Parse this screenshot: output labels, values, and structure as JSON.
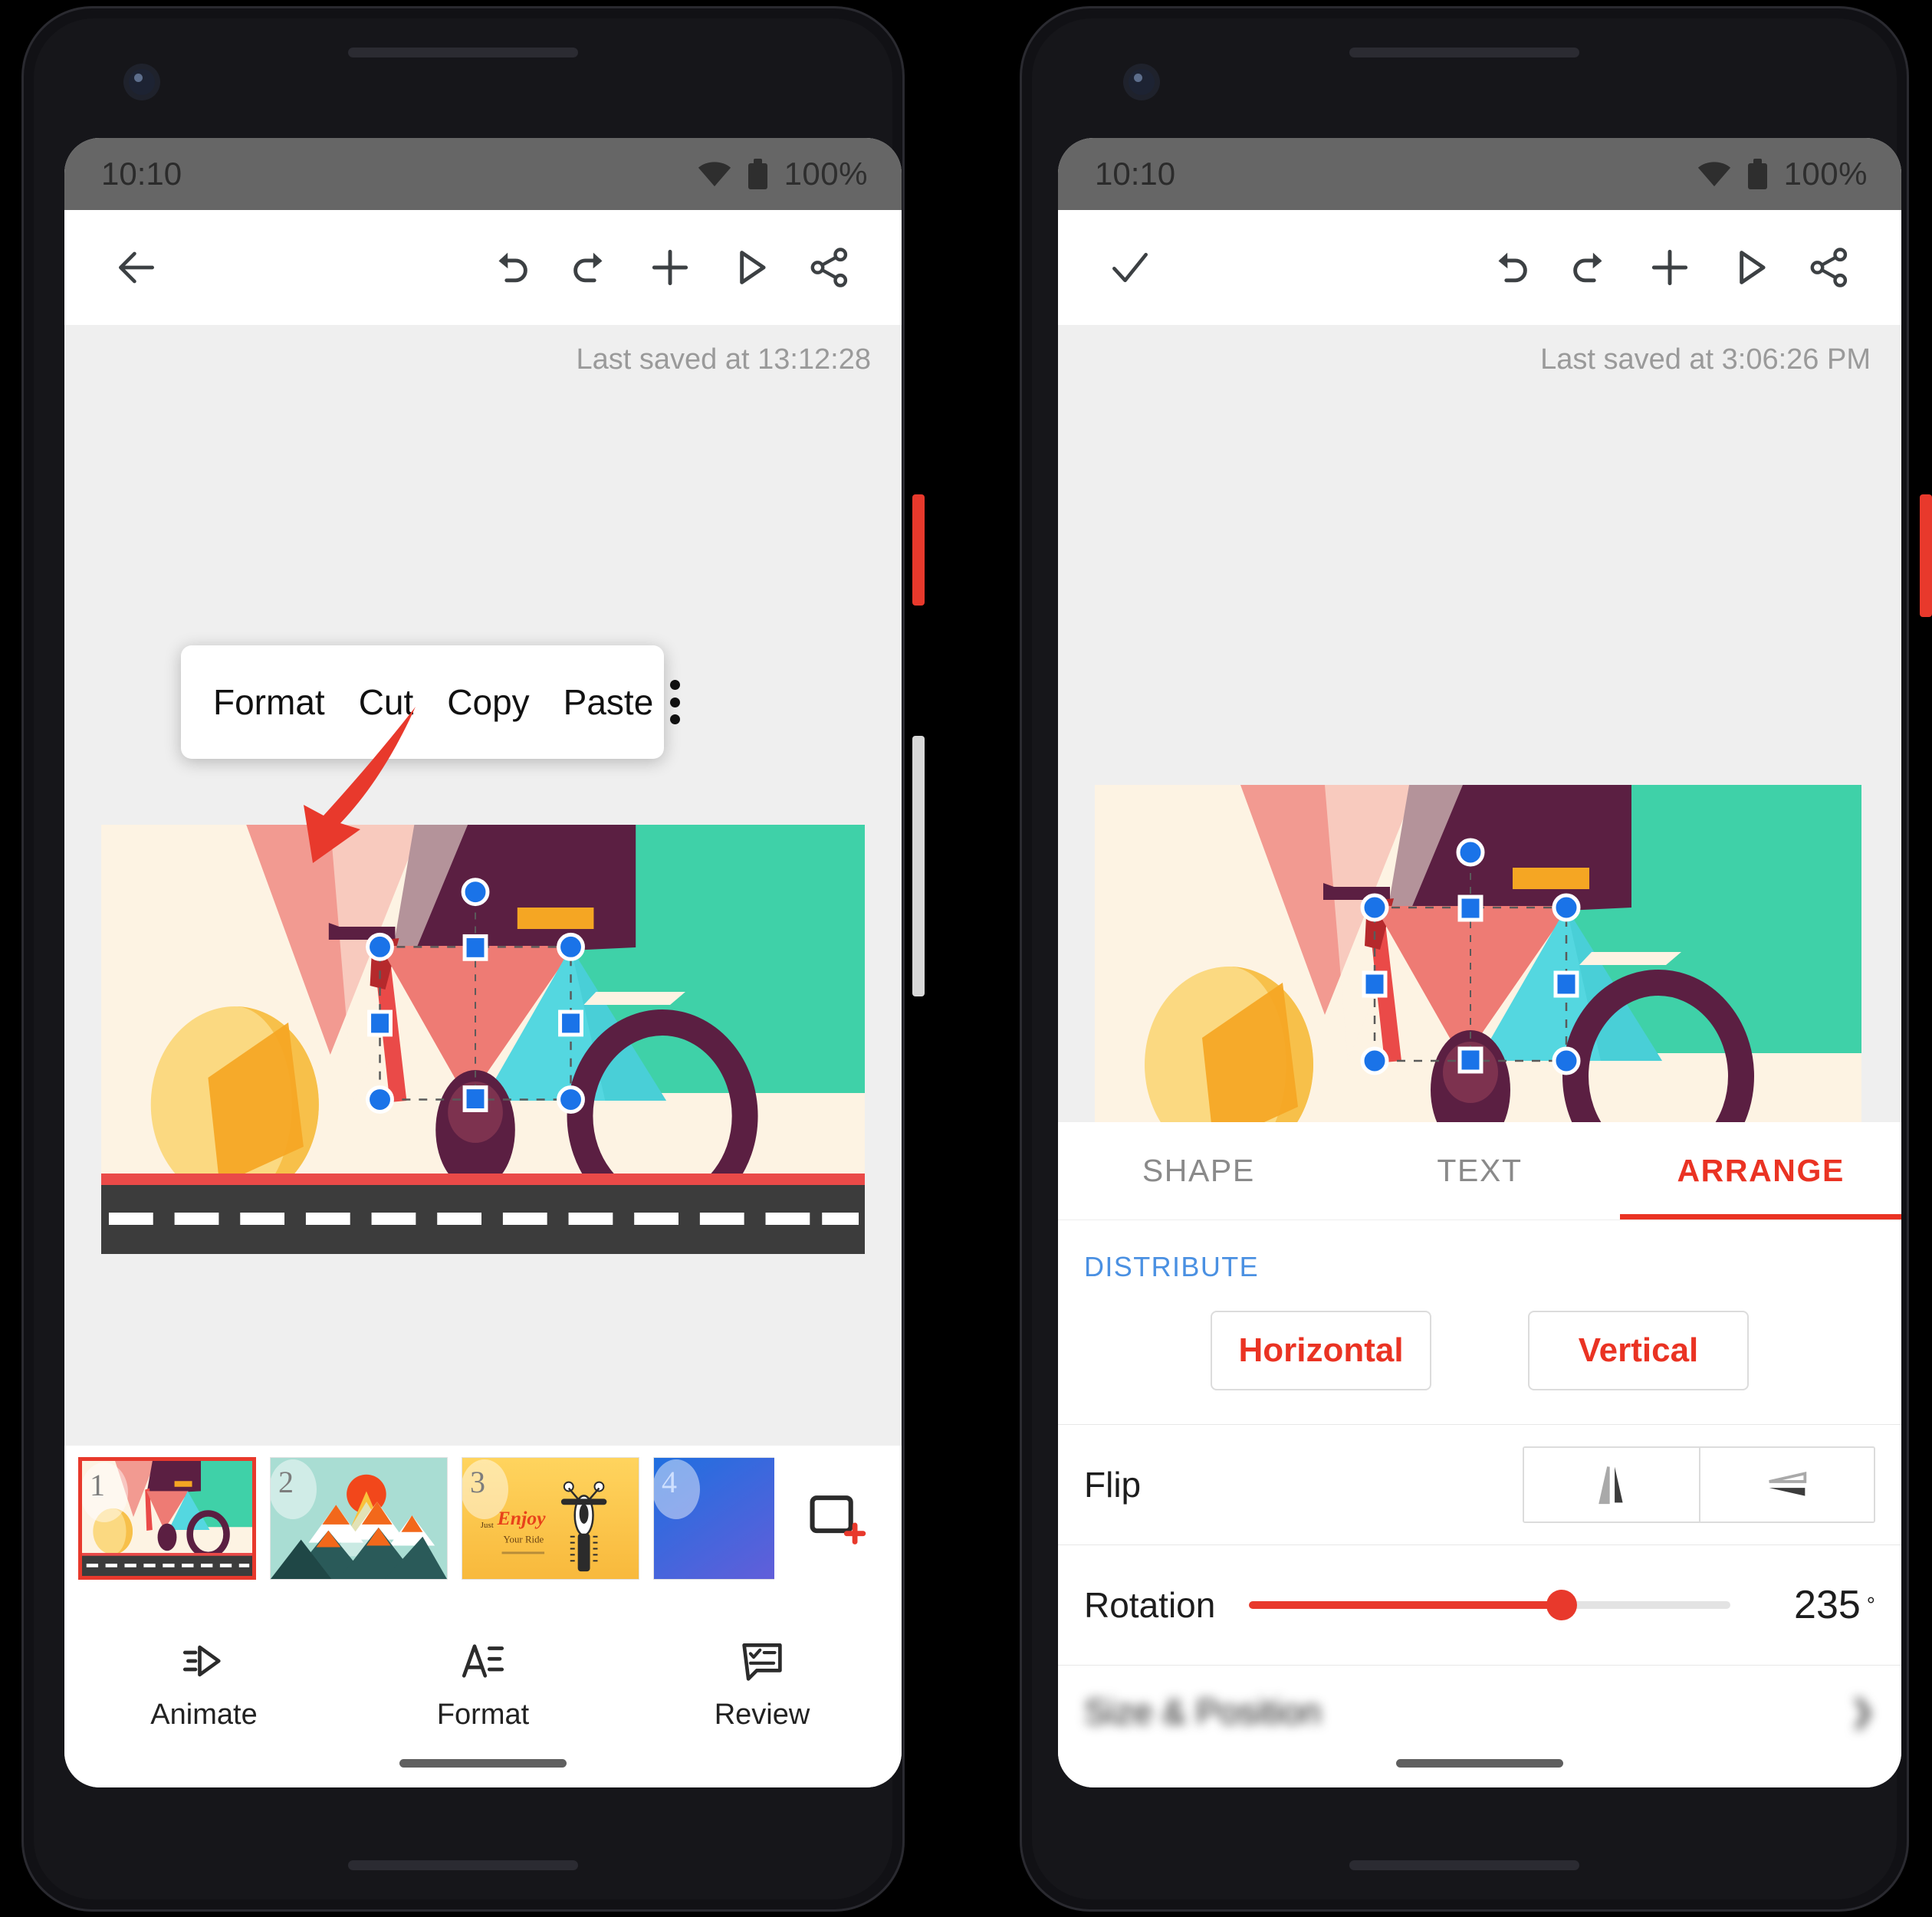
{
  "status_bar": {
    "time": "10:10",
    "battery_percent": "100%",
    "wifi_icon": "wifi-icon",
    "battery_icon": "battery-icon"
  },
  "left_phone": {
    "toolbar": {
      "back_icon": "back-arrow-icon",
      "undo_icon": "undo-icon",
      "redo_icon": "redo-icon",
      "add_icon": "plus-icon",
      "present_icon": "present-play-icon",
      "share_icon": "share-icon"
    },
    "last_saved": "Last saved at 13:12:28",
    "context_menu": {
      "items": [
        {
          "label": "Format"
        },
        {
          "label": "Cut"
        },
        {
          "label": "Copy"
        },
        {
          "label": "Paste"
        }
      ],
      "overflow_icon": "more-vertical-icon"
    },
    "annotation": {
      "arrow_color": "#e8392c",
      "points_to": "Format"
    },
    "filmstrip": {
      "slides": [
        {
          "number": "1",
          "selected": true
        },
        {
          "number": "2",
          "selected": false
        },
        {
          "number": "3",
          "selected": false
        },
        {
          "number": "4",
          "selected": false
        }
      ],
      "add_slide_icon": "add-slide-icon"
    },
    "bottom_nav": [
      {
        "label": "Animate",
        "icon": "animate-icon"
      },
      {
        "label": "Format",
        "icon": "format-text-icon"
      },
      {
        "label": "Review",
        "icon": "review-comment-icon"
      }
    ]
  },
  "right_phone": {
    "toolbar": {
      "confirm_icon": "checkmark-icon",
      "undo_icon": "undo-icon",
      "redo_icon": "redo-icon",
      "add_icon": "plus-icon",
      "present_icon": "present-play-icon",
      "share_icon": "share-icon"
    },
    "last_saved": "Last saved at 3:06:26 PM",
    "panel": {
      "tabs": [
        {
          "label": "SHAPE",
          "active": false
        },
        {
          "label": "TEXT",
          "active": false
        },
        {
          "label": "ARRANGE",
          "active": true
        }
      ],
      "distribute": {
        "section_label": "DISTRIBUTE",
        "horizontal_label": "Horizontal",
        "vertical_label": "Vertical"
      },
      "flip": {
        "label": "Flip",
        "horizontal_icon": "flip-horizontal-icon",
        "vertical_icon": "flip-vertical-icon"
      },
      "rotation": {
        "label": "Rotation",
        "value": "235",
        "unit": "°",
        "percent": 65
      },
      "size_position": {
        "label": "Size & Position",
        "chevron_icon": "chevron-right-icon"
      }
    }
  },
  "slide_artwork": {
    "name": "flat-bicycle-illustration",
    "colors": {
      "cream": "#fdf3e3",
      "salmon": "#f29a91",
      "plum": "#5b1f42",
      "teal": "#3fd1a8",
      "red": "#ea4a48",
      "cyan": "#54d7e0",
      "yellow": "#f9c23c",
      "orange": "#f5a623",
      "road": "#3c3c3c"
    },
    "selection": {
      "handle_color": "#1a73e8",
      "rotation_handle": true
    }
  },
  "theme": {
    "accent_red": "#e8392c",
    "link_blue": "#4a90e2",
    "status_gray": "#666666",
    "canvas_gray": "#efefef"
  }
}
